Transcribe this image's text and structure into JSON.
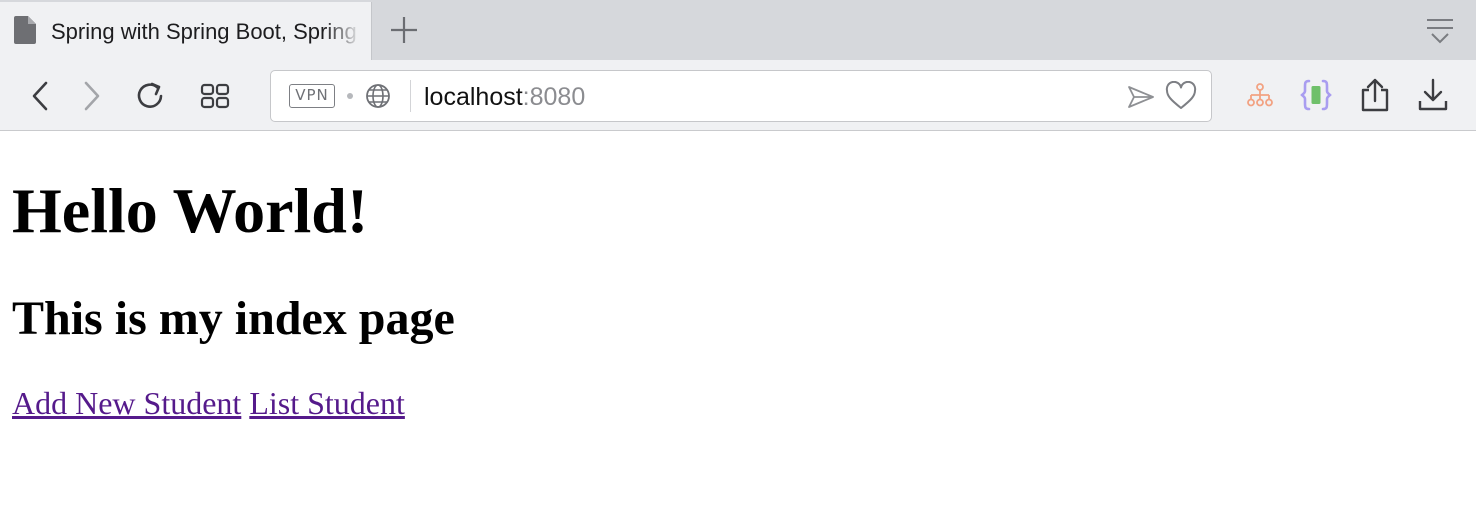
{
  "browser": {
    "tab": {
      "title": "Spring with Spring Boot, Spring MVC"
    },
    "address_bar": {
      "vpn_label": "VPN",
      "host": "localhost",
      "port": ":8080"
    },
    "icons": {
      "tab": "document-icon",
      "new_tab": "plus-icon",
      "tab_menu": "tab-menu-icon",
      "back": "chevron-left-icon",
      "forward": "chevron-right-icon",
      "reload": "reload-icon",
      "speed_dial": "grid-icon",
      "globe": "globe-icon",
      "send": "send-icon",
      "bookmark": "heart-icon",
      "extension_1": "sitemap-icon",
      "extension_2": "json-braces-icon",
      "share": "share-icon",
      "download": "download-icon"
    },
    "colors": {
      "chrome": "#f0f1f3",
      "tabstrip": "#d6d8dc",
      "visited_link": "#551a8b"
    }
  },
  "page": {
    "heading": "Hello World!",
    "subheading": "This is my index page",
    "links": [
      {
        "label": "Add New Student"
      },
      {
        "label": "List Student"
      }
    ]
  }
}
